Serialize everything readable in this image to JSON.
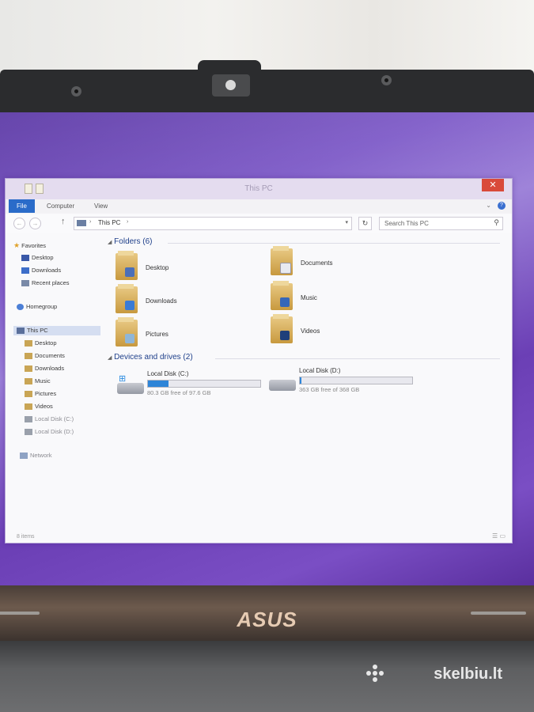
{
  "window": {
    "title": "This PC",
    "close_glyph": "✕",
    "ribbon": {
      "tabs": [
        "File",
        "Computer",
        "View"
      ],
      "help": "?"
    },
    "address": {
      "crumb": "This PC"
    },
    "search_placeholder": "Search This PC"
  },
  "sidebar": {
    "favorites": "Favorites",
    "fav_items": [
      "Desktop",
      "Downloads",
      "Recent places"
    ],
    "homegroup": "Homegroup",
    "this_pc": "This PC",
    "pc_items": [
      "Desktop",
      "Documents",
      "Downloads",
      "Music",
      "Pictures",
      "Videos",
      "Local Disk (C:)",
      "Local Disk (D:)"
    ],
    "network": "Network"
  },
  "content": {
    "folders_header": "Folders (6)",
    "folders": [
      {
        "label": "Desktop",
        "icon": "desktop-folder-icon"
      },
      {
        "label": "Documents",
        "icon": "documents-folder-icon"
      },
      {
        "label": "Downloads",
        "icon": "downloads-folder-icon"
      },
      {
        "label": "Music",
        "icon": "music-folder-icon"
      },
      {
        "label": "Pictures",
        "icon": "pictures-folder-icon"
      },
      {
        "label": "Videos",
        "icon": "videos-folder-icon"
      }
    ],
    "drives_header": "Devices and drives (2)",
    "drives": [
      {
        "name": "Local Disk (C:)",
        "free": "80.3 GB free of 97.6 GB",
        "used_fraction": 0.18
      },
      {
        "name": "Local Disk (D:)",
        "free": "363 GB free of 368 GB",
        "used_fraction": 0.014
      }
    ]
  },
  "status": {
    "items": "8 items"
  },
  "branding": {
    "laptop_logo": "ASUS",
    "watermark": "skelbiu.lt"
  },
  "colors": {
    "accent": "#2e85d8",
    "close": "#d94a3a",
    "wallpaper": "#7e5bc8"
  }
}
